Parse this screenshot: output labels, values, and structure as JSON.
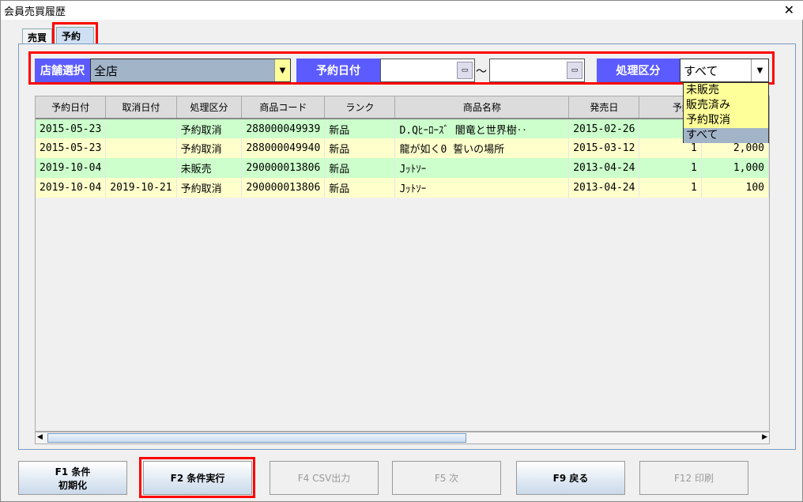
{
  "window": {
    "title": "会員売買履歴",
    "close": "✕"
  },
  "tabs": [
    {
      "label": "売買"
    },
    {
      "label": "予約"
    }
  ],
  "filters": {
    "store_label": "店舗選択",
    "store_value": "全店",
    "date_label": "予約日付",
    "date_from": "",
    "date_to": "",
    "date_sep": "～",
    "status_label": "処理区分",
    "status_value": "すべて",
    "status_options": [
      "未販売",
      "販売済み",
      "予約取消",
      "すべて"
    ]
  },
  "table": {
    "headers": [
      "予約日付",
      "取消日付",
      "処理区分",
      "商品コード",
      "ランク",
      "商品名称",
      "発売日",
      "予約数",
      ""
    ],
    "rows": [
      [
        "2015-05-23",
        "",
        "予約取消",
        "288000049939",
        "新品",
        "D.Qﾋｰﾛｰｽﾞ 闇竜と世界樹‥",
        "2015-02-26",
        "",
        ""
      ],
      [
        "2015-05-23",
        "",
        "予約取消",
        "288000049940",
        "新品",
        "龍が如く0 誓いの場所",
        "2015-03-12",
        "1",
        "2,000"
      ],
      [
        "2019-10-04",
        "",
        "未販売",
        "290000013806",
        "新品",
        "Jｯﾄｿｰ",
        "2013-04-24",
        "1",
        "1,000"
      ],
      [
        "2019-10-04",
        "2019-10-21",
        "予約取消",
        "290000013806",
        "新品",
        "Jｯﾄｿｰ",
        "2013-04-24",
        "1",
        "100"
      ]
    ]
  },
  "buttons": [
    {
      "label": "F1 条件\n初期化",
      "enabled": true
    },
    {
      "label": "F2 条件実行",
      "enabled": true
    },
    {
      "label": "F4 CSV出力",
      "enabled": false
    },
    {
      "label": "F5 次",
      "enabled": false
    },
    {
      "label": "F9 戻る",
      "enabled": true
    },
    {
      "label": "F12 印刷",
      "enabled": false
    }
  ],
  "colors": {
    "label_bg": "#5b5bff",
    "highlight": "#ff0000",
    "row_green": "#ccffcc",
    "row_yellow": "#ffffcc"
  }
}
